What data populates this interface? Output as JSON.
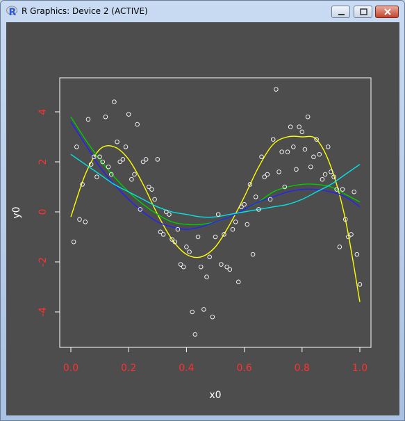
{
  "window": {
    "title": "R Graphics: Device 2 (ACTIVE)"
  },
  "chart_data": {
    "type": "scatter",
    "xlabel": "x0",
    "ylabel": "y0",
    "xlim": [
      0.0,
      1.0
    ],
    "ylim": [
      -5.2,
      5.2
    ],
    "xticks": [
      "0.0",
      "0.2",
      "0.4",
      "0.6",
      "0.8",
      "1.0"
    ],
    "yticks": [
      "-4",
      "-2",
      "0",
      "2",
      "4"
    ],
    "grid": false,
    "colors": {
      "background": "#4d4d4d",
      "frame": "#ffffff",
      "tick_labels": "#ff3030",
      "points": "#ffffff"
    },
    "points": [
      [
        0.01,
        -1.2
      ],
      [
        0.02,
        2.6
      ],
      [
        0.03,
        -0.3
      ],
      [
        0.04,
        1.1
      ],
      [
        0.05,
        -0.4
      ],
      [
        0.06,
        3.7
      ],
      [
        0.07,
        1.9
      ],
      [
        0.08,
        2.2
      ],
      [
        0.09,
        1.4
      ],
      [
        0.1,
        2.2
      ],
      [
        0.11,
        2.0
      ],
      [
        0.12,
        3.8
      ],
      [
        0.13,
        1.8
      ],
      [
        0.14,
        1.5
      ],
      [
        0.15,
        4.4
      ],
      [
        0.16,
        2.8
      ],
      [
        0.17,
        2.0
      ],
      [
        0.18,
        2.1
      ],
      [
        0.19,
        2.6
      ],
      [
        0.2,
        3.9
      ],
      [
        0.21,
        1.3
      ],
      [
        0.22,
        1.5
      ],
      [
        0.23,
        3.5
      ],
      [
        0.24,
        0.1
      ],
      [
        0.25,
        2.0
      ],
      [
        0.26,
        2.1
      ],
      [
        0.27,
        1.0
      ],
      [
        0.28,
        0.9
      ],
      [
        0.29,
        0.5
      ],
      [
        0.3,
        2.1
      ],
      [
        0.31,
        -0.8
      ],
      [
        0.32,
        -0.9
      ],
      [
        0.33,
        0.0
      ],
      [
        0.34,
        -0.1
      ],
      [
        0.35,
        -1.1
      ],
      [
        0.36,
        -1.2
      ],
      [
        0.37,
        -0.7
      ],
      [
        0.38,
        -2.1
      ],
      [
        0.39,
        -2.2
      ],
      [
        0.4,
        -1.4
      ],
      [
        0.41,
        -1.6
      ],
      [
        0.42,
        -4.0
      ],
      [
        0.43,
        -4.9
      ],
      [
        0.44,
        -1.0
      ],
      [
        0.45,
        -2.2
      ],
      [
        0.46,
        -3.9
      ],
      [
        0.47,
        -2.6
      ],
      [
        0.48,
        -1.8
      ],
      [
        0.49,
        -4.2
      ],
      [
        0.5,
        -1.0
      ],
      [
        0.51,
        -0.1
      ],
      [
        0.52,
        -2.1
      ],
      [
        0.53,
        -0.9
      ],
      [
        0.54,
        -2.2
      ],
      [
        0.55,
        -2.3
      ],
      [
        0.56,
        -0.7
      ],
      [
        0.57,
        -0.4
      ],
      [
        0.58,
        -2.8
      ],
      [
        0.59,
        0.2
      ],
      [
        0.6,
        0.3
      ],
      [
        0.61,
        -0.5
      ],
      [
        0.62,
        1.1
      ],
      [
        0.63,
        -1.7
      ],
      [
        0.64,
        0.6
      ],
      [
        0.65,
        0.1
      ],
      [
        0.66,
        2.2
      ],
      [
        0.67,
        1.4
      ],
      [
        0.68,
        1.5
      ],
      [
        0.69,
        0.5
      ],
      [
        0.7,
        2.9
      ],
      [
        0.71,
        4.9
      ],
      [
        0.72,
        1.6
      ],
      [
        0.73,
        2.4
      ],
      [
        0.74,
        1.0
      ],
      [
        0.75,
        2.4
      ],
      [
        0.76,
        3.4
      ],
      [
        0.77,
        2.6
      ],
      [
        0.78,
        1.7
      ],
      [
        0.79,
        3.4
      ],
      [
        0.8,
        3.2
      ],
      [
        0.81,
        2.5
      ],
      [
        0.82,
        3.8
      ],
      [
        0.83,
        1.8
      ],
      [
        0.84,
        2.2
      ],
      [
        0.85,
        2.9
      ],
      [
        0.86,
        2.3
      ],
      [
        0.87,
        1.3
      ],
      [
        0.88,
        1.5
      ],
      [
        0.89,
        2.6
      ],
      [
        0.9,
        1.6
      ],
      [
        0.91,
        1.4
      ],
      [
        0.92,
        0.9
      ],
      [
        0.93,
        -1.4
      ],
      [
        0.94,
        0.9
      ],
      [
        0.95,
        -0.3
      ],
      [
        0.96,
        -1.0
      ],
      [
        0.97,
        -0.9
      ],
      [
        0.98,
        0.8
      ],
      [
        0.99,
        -1.7
      ],
      [
        1.0,
        -2.9
      ]
    ],
    "series": [
      {
        "color": "#ffff00",
        "x": [
          0.0,
          0.05,
          0.1,
          0.15,
          0.2,
          0.25,
          0.3,
          0.35,
          0.4,
          0.45,
          0.5,
          0.55,
          0.6,
          0.65,
          0.7,
          0.75,
          0.8,
          0.85,
          0.9,
          0.95,
          1.0
        ],
        "y": [
          -0.2,
          1.5,
          2.5,
          2.6,
          2.1,
          1.1,
          -0.1,
          -1.1,
          -1.7,
          -1.8,
          -1.4,
          -0.5,
          0.6,
          1.8,
          2.7,
          3.0,
          3.0,
          2.9,
          1.8,
          -0.3,
          -3.6
        ]
      },
      {
        "color": "#00cc00",
        "x": [
          0.0,
          0.05,
          0.1,
          0.15,
          0.2,
          0.25,
          0.3,
          0.35,
          0.4,
          0.45,
          0.5,
          0.55,
          0.6,
          0.65,
          0.7,
          0.75,
          0.8,
          0.85,
          0.9,
          0.95,
          1.0
        ],
        "y": [
          3.8,
          2.9,
          2.1,
          1.4,
          0.8,
          0.3,
          -0.1,
          -0.4,
          -0.5,
          -0.5,
          -0.4,
          -0.2,
          0.1,
          0.4,
          0.8,
          1.0,
          1.1,
          1.1,
          1.0,
          0.7,
          0.4
        ]
      },
      {
        "color": "#2222ff",
        "x": [
          0.0,
          0.05,
          0.1,
          0.15,
          0.2,
          0.25,
          0.3,
          0.35,
          0.4,
          0.45,
          0.5,
          0.55,
          0.6,
          0.65,
          0.7,
          0.75,
          0.8,
          0.85,
          0.9,
          0.95,
          1.0
        ],
        "y": [
          3.6,
          2.7,
          1.8,
          1.1,
          0.5,
          0.0,
          -0.4,
          -0.6,
          -0.7,
          -0.6,
          -0.4,
          -0.2,
          0.1,
          0.4,
          0.6,
          0.8,
          0.9,
          0.9,
          0.8,
          0.6,
          0.2
        ]
      },
      {
        "color": "#00e5e5",
        "x": [
          0.0,
          0.05,
          0.1,
          0.15,
          0.2,
          0.25,
          0.3,
          0.35,
          0.4,
          0.45,
          0.5,
          0.55,
          0.6,
          0.65,
          0.7,
          0.75,
          0.8,
          0.85,
          0.9,
          0.95,
          1.0
        ],
        "y": [
          2.3,
          1.9,
          1.5,
          1.1,
          0.8,
          0.5,
          0.2,
          0.0,
          -0.1,
          -0.2,
          -0.2,
          -0.1,
          0.0,
          0.1,
          0.2,
          0.3,
          0.5,
          0.8,
          1.1,
          1.5,
          1.9
        ]
      }
    ]
  }
}
